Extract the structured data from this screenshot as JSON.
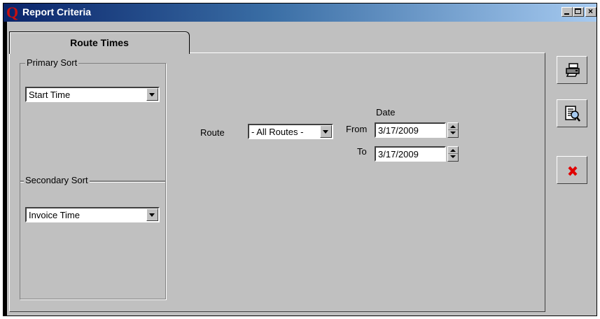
{
  "window": {
    "title": "Report Criteria",
    "app_icon": "Q",
    "title_bar_colors": [
      "#0a246a",
      "#a6caf0"
    ]
  },
  "tabs": [
    {
      "label": "Route Times",
      "selected": true
    }
  ],
  "primary_sort": {
    "legend": "Primary Sort",
    "value": "Start Time"
  },
  "secondary_sort": {
    "legend": "Secondary Sort",
    "value": "Invoice Time"
  },
  "route": {
    "label": "Route",
    "value": "- All Routes -"
  },
  "date": {
    "header": "Date",
    "from_label": "From",
    "from_value": "3/17/2009",
    "to_label": "To",
    "to_value": "3/17/2009"
  },
  "toolbar": {
    "print_icon": "printer-icon",
    "preview_icon": "report-preview-icon",
    "close_icon": "close-icon",
    "close_color": "#e00000"
  }
}
